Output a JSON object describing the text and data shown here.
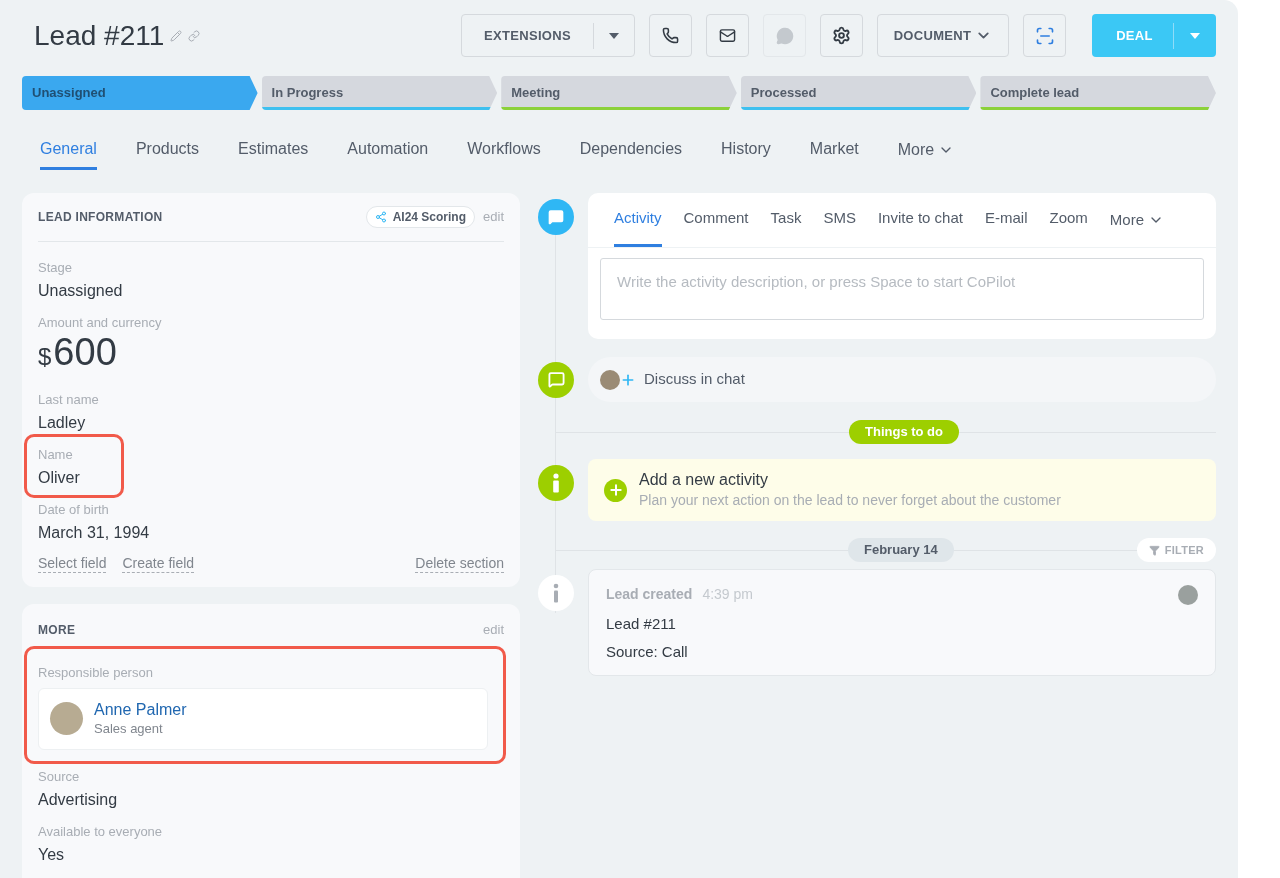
{
  "header": {
    "title": "Lead #211",
    "buttons": [
      {
        "kind": "split",
        "label": "EXTENSIONS"
      },
      {
        "kind": "icon",
        "disabled": false
      },
      {
        "kind": "icon",
        "disabled": false
      },
      {
        "kind": "icon",
        "disabled": true
      },
      {
        "kind": "icon",
        "disabled": false
      },
      {
        "kind": "dropdown",
        "label": "DOCUMENT"
      },
      {
        "kind": "icon",
        "disabled": false
      },
      {
        "kind": "primary_split",
        "label": "DEAL"
      }
    ]
  },
  "stages": [
    {
      "label": "Unassigned",
      "selected": true,
      "color": "#3aa8ef"
    },
    {
      "label": "In Progress",
      "selected": false,
      "color": "#3ec0ef"
    },
    {
      "label": "Meeting",
      "selected": false,
      "color": "#8cd13a"
    },
    {
      "label": "Processed",
      "selected": false,
      "color": "#3ec0ef"
    },
    {
      "label": "Complete lead",
      "selected": false,
      "color": "#8cd13a"
    }
  ],
  "tabs": [
    {
      "label": "General",
      "selected": true,
      "kind": "tab"
    },
    {
      "label": "Products",
      "selected": false,
      "kind": "tab"
    },
    {
      "label": "Estimates",
      "selected": false,
      "kind": "tab"
    },
    {
      "label": "Automation",
      "selected": false,
      "kind": "tab"
    },
    {
      "label": "Workflows",
      "selected": false,
      "kind": "tab"
    },
    {
      "label": "Dependencies",
      "selected": false,
      "kind": "tab"
    },
    {
      "label": "History",
      "selected": false,
      "kind": "tab"
    },
    {
      "label": "Market",
      "selected": false,
      "kind": "tab"
    },
    {
      "label": "More",
      "selected": false,
      "kind": "menu"
    }
  ],
  "lead_information": {
    "title": "LEAD INFORMATION",
    "badge": "AI24 Scoring",
    "edit": "edit",
    "fields": [
      {
        "kind": "text",
        "label": "Stage",
        "value": "Unassigned",
        "highlighted": false
      },
      {
        "kind": "amount",
        "label": "Amount and currency",
        "currency": "$",
        "value": "600",
        "highlighted": false
      },
      {
        "kind": "text",
        "label": "Last name",
        "value": "Ladley",
        "highlighted": false
      },
      {
        "kind": "text",
        "label": "Name",
        "value": "Oliver",
        "highlighted": true
      },
      {
        "kind": "text",
        "label": "Date of birth",
        "value": "March 31, 1994",
        "highlighted": false
      }
    ],
    "links": [
      "Select field",
      "Create field"
    ],
    "delete": "Delete section"
  },
  "more": {
    "title": "MORE",
    "edit": "edit",
    "responsible": {
      "label": "Responsible person",
      "name": "Anne Palmer",
      "role": "Sales agent",
      "highlighted": true
    },
    "fields": [
      {
        "kind": "text",
        "label": "Source",
        "value": "Advertising",
        "highlighted": false
      },
      {
        "kind": "text",
        "label": "Available to everyone",
        "value": "Yes",
        "highlighted": false
      }
    ]
  },
  "timeline": {
    "composer": {
      "tabs": [
        {
          "label": "Activity",
          "selected": true,
          "kind": "tab"
        },
        {
          "label": "Comment",
          "selected": false,
          "kind": "tab"
        },
        {
          "label": "Task",
          "selected": false,
          "kind": "tab"
        },
        {
          "label": "SMS",
          "selected": false,
          "kind": "tab"
        },
        {
          "label": "Invite to chat",
          "selected": false,
          "kind": "tab"
        },
        {
          "label": "E-mail",
          "selected": false,
          "kind": "tab"
        },
        {
          "label": "Zoom",
          "selected": false,
          "kind": "tab"
        },
        {
          "label": "More",
          "selected": false,
          "kind": "menu"
        }
      ],
      "placeholder": "Write the activity description, or press Space to start CoPilot"
    },
    "chat": "Discuss in chat",
    "todo": "Things to do",
    "add_activity": {
      "title": "Add a new activity",
      "subtitle": "Plan your next action on the lead to never forget about the customer"
    },
    "date": "February 14",
    "filter": "FILTER",
    "event": {
      "title": "Lead created",
      "time": "4:39 pm",
      "lines": [
        "Lead #211",
        "Source: Call"
      ]
    }
  }
}
